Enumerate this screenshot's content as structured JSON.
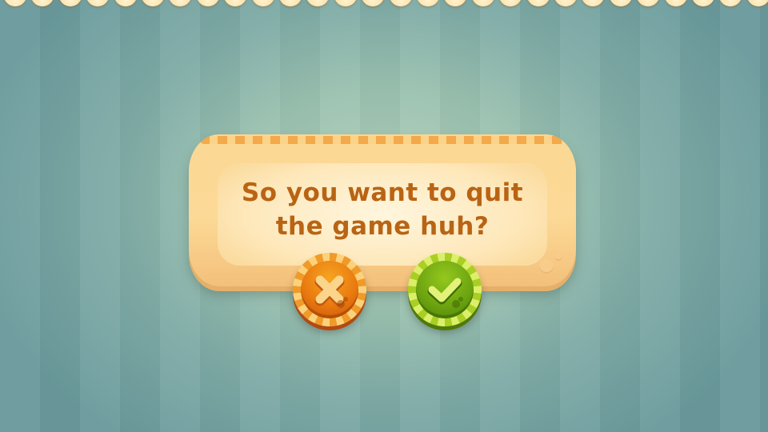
{
  "dialog": {
    "message_line1": "So you want to quit",
    "message_line2": "the game huh?"
  },
  "buttons": {
    "cancel_icon": "close-x-icon",
    "confirm_icon": "checkmark-icon"
  },
  "colors": {
    "text": "#b96414",
    "cancel": "#e97a10",
    "confirm": "#6ea510",
    "frame": "#fbd894",
    "background": "#9cc2b0"
  }
}
